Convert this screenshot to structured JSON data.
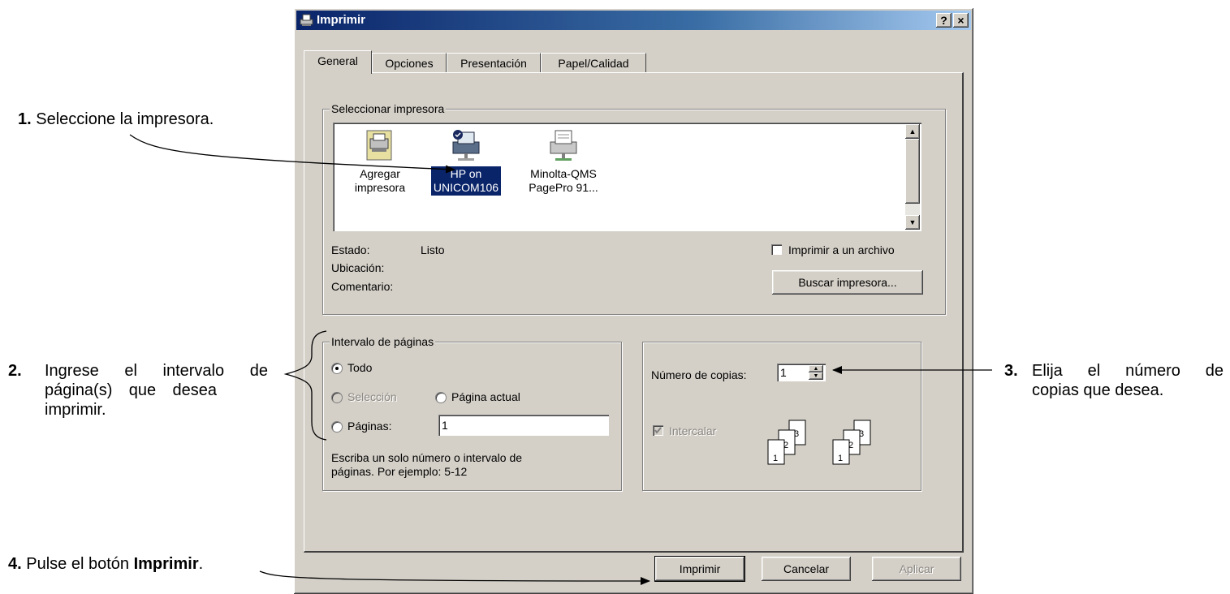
{
  "annotations": {
    "step1": {
      "num": "1.",
      "text": "Seleccione la impresora."
    },
    "step2": {
      "num": "2.",
      "line1": "Ingrese el intervalo de",
      "line2": "página(s) que desea",
      "line3": "imprimir."
    },
    "step3": {
      "num": "3.",
      "line1": "Elija el número de",
      "line2": "copias que desea."
    },
    "step4": {
      "num": "4.",
      "text_pre": "Pulse el botón ",
      "text_bold": "Imprimir",
      "text_post": "."
    }
  },
  "dialog": {
    "title": "Imprimir",
    "help_button": "?",
    "close_button": "×",
    "tabs": [
      "General",
      "Opciones",
      "Presentación",
      "Papel/Calidad"
    ],
    "active_tab": "General"
  },
  "select_printer": {
    "group_title": "Seleccionar impresora",
    "printers": [
      {
        "line1": "Agregar",
        "line2": "impresora",
        "icon": "add-printer-icon",
        "selected": false
      },
      {
        "line1": "HP on",
        "line2": "UNICOM106",
        "icon": "network-printer-icon",
        "selected": true
      },
      {
        "line1": "Minolta-QMS",
        "line2": "PagePro 91...",
        "icon": "printer-icon",
        "selected": false
      }
    ],
    "status_label": "Estado:",
    "status_value": "Listo",
    "location_label": "Ubicación:",
    "comment_label": "Comentario:",
    "print_to_file_label": "Imprimir a un archivo",
    "print_to_file_checked": false,
    "find_printer_button": "Buscar impresora..."
  },
  "page_range": {
    "group_title": "Intervalo de páginas",
    "all_label": "Todo",
    "selection_label": "Selección",
    "current_page_label": "Página actual",
    "pages_label": "Páginas:",
    "pages_value": "1",
    "hint_line1": "Escriba un solo número o intervalo de",
    "hint_line2": "páginas. Por ejemplo: 5-12",
    "selected_option": "Todo"
  },
  "copies": {
    "label": "Número de copias:",
    "value": "1",
    "collate_label": "Intercalar",
    "collate_checked": true,
    "collate_enabled": false,
    "collate_pages": [
      "1",
      "2",
      "3"
    ]
  },
  "buttons": {
    "print": "Imprimir",
    "cancel": "Cancelar",
    "apply": "Aplicar"
  },
  "colors": {
    "dialog_bg": "#d4d0c8",
    "title_bar": "#0a246a",
    "selection": "#0a246a"
  }
}
